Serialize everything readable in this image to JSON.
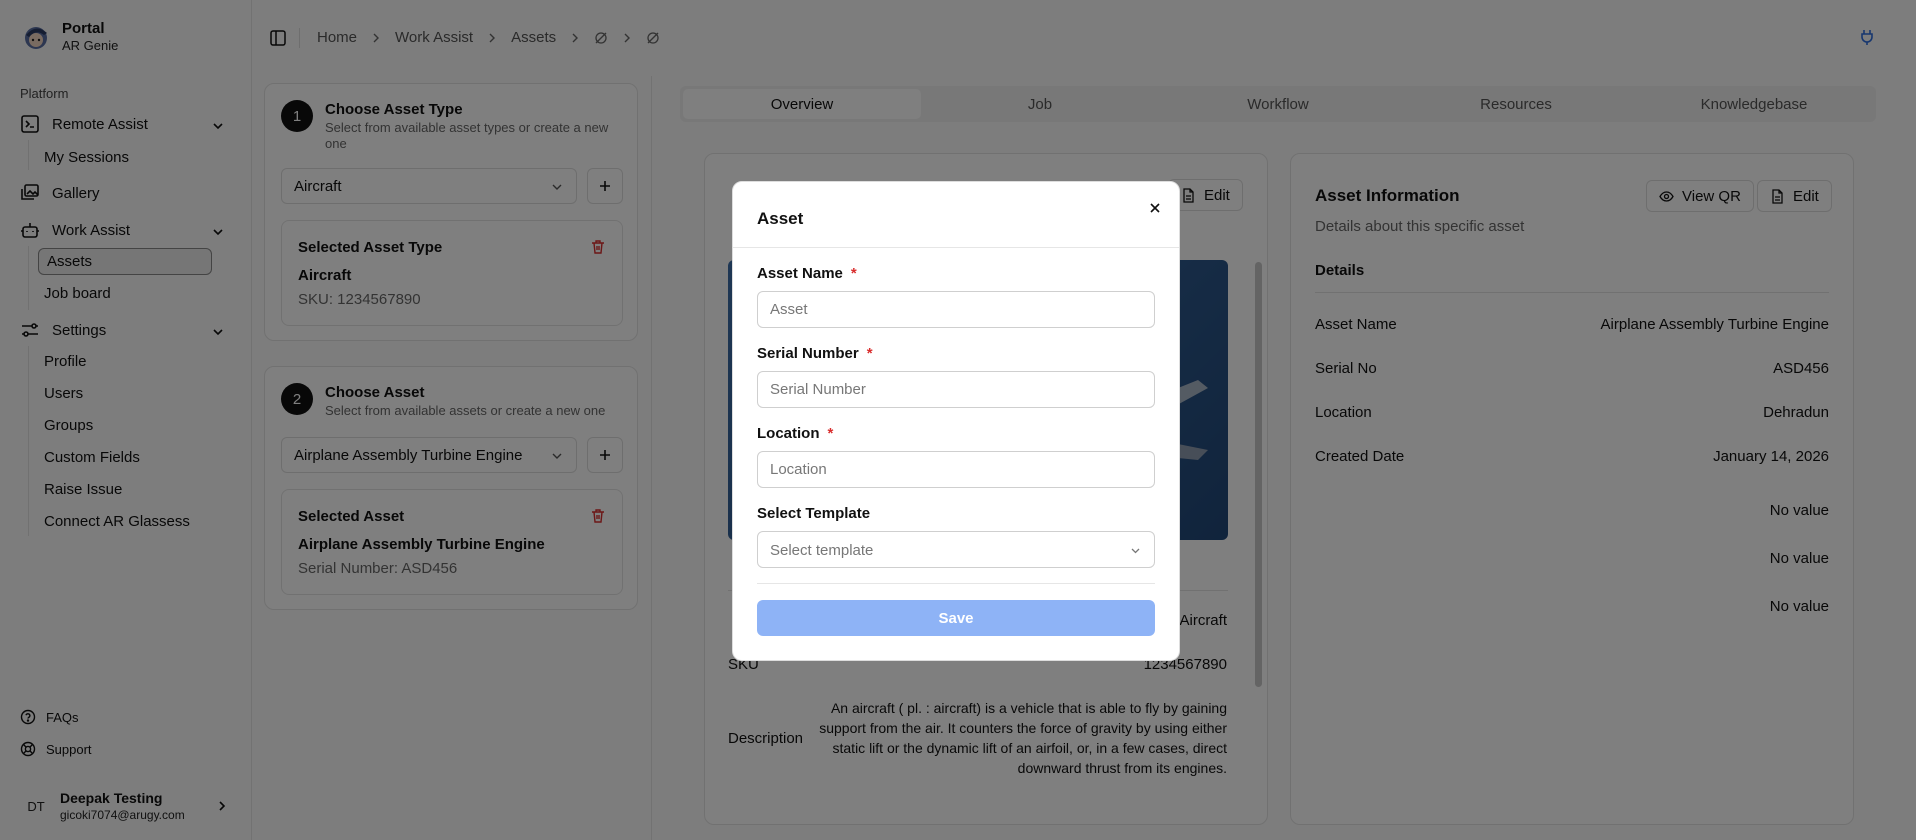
{
  "brand": {
    "name": "Portal",
    "subtitle": "AR Genie"
  },
  "sidebar": {
    "section_label": "Platform",
    "groups": [
      {
        "label": "Remote Assist",
        "icon": "terminal-square-icon",
        "items": [
          "My Sessions"
        ]
      },
      {
        "label": "Gallery",
        "icon": "images-icon"
      },
      {
        "label": "Work Assist",
        "icon": "bot-icon",
        "items": [
          "Assets",
          "Job board"
        ]
      },
      {
        "label": "Settings",
        "icon": "settings-sliders-icon",
        "items": [
          "Profile",
          "Users",
          "Groups",
          "Custom Fields",
          "Raise Issue",
          "Connect AR Glassess"
        ]
      }
    ],
    "active_item": "Assets",
    "footer": [
      {
        "label": "FAQs",
        "icon": "help-circle-icon"
      },
      {
        "label": "Support",
        "icon": "life-buoy-icon"
      }
    ],
    "user": {
      "initials": "DT",
      "name": "Deepak Testing",
      "email": "gicoki7074@arugy.com"
    }
  },
  "breadcrumb": [
    "Home",
    "Work Assist",
    "Assets"
  ],
  "left_panel": {
    "step1": {
      "number": "1",
      "title": "Choose Asset Type",
      "subtitle": "Select from available asset types or create a new one",
      "selected_value": "Aircraft",
      "selected_header": "Selected Asset Type",
      "selected_name": "Aircraft",
      "selected_detail": "SKU: 1234567890"
    },
    "step2": {
      "number": "2",
      "title": "Choose Asset",
      "subtitle": "Select from available assets or create a new one",
      "selected_value": "Airplane Assembly Turbine Engine",
      "selected_header": "Selected Asset",
      "selected_name": "Airplane Assembly Turbine Engine",
      "selected_detail": "Serial Number: ASD456"
    }
  },
  "tabs": [
    "Overview",
    "Job",
    "Workflow",
    "Resources",
    "Knowledgebase"
  ],
  "active_tab": "Overview",
  "asset_type_card": {
    "edit_label": "Edit",
    "type_value": "Aircraft",
    "sku_label": "SKU",
    "sku_value": "1234567890",
    "description_label": "Description",
    "description": "An aircraft ( pl. : aircraft) is a vehicle that is able to fly by gaining support from the air. It counters the force of gravity by using either static lift or the dynamic lift of an airfoil, or, in a few cases, direct downward thrust from its engines."
  },
  "asset_info_card": {
    "title": "Asset Information",
    "subtitle": "Details about this specific asset",
    "view_qr_label": "View QR",
    "edit_label": "Edit",
    "details_heading": "Details",
    "rows": [
      {
        "label": "Asset Name",
        "value": "Airplane Assembly Turbine Engine"
      },
      {
        "label": "Serial No",
        "value": "ASD456"
      },
      {
        "label": "Location",
        "value": "Dehradun"
      },
      {
        "label": "Created Date",
        "value": "January 14, 2026"
      }
    ],
    "custom_values": [
      "No value",
      "No value",
      "No value"
    ]
  },
  "modal": {
    "title": "Asset",
    "asset_name_label": "Asset Name",
    "asset_name_placeholder": "Asset",
    "serial_label": "Serial Number",
    "serial_placeholder": "Serial Number",
    "location_label": "Location",
    "location_placeholder": "Location",
    "template_label": "Select Template",
    "template_placeholder": "Select template",
    "required_mark": "*",
    "save_label": "Save"
  },
  "colors": {
    "primary_disabled": "#8eb3f6",
    "danger": "#d92d2d",
    "accent_icon": "#2f6fde"
  }
}
